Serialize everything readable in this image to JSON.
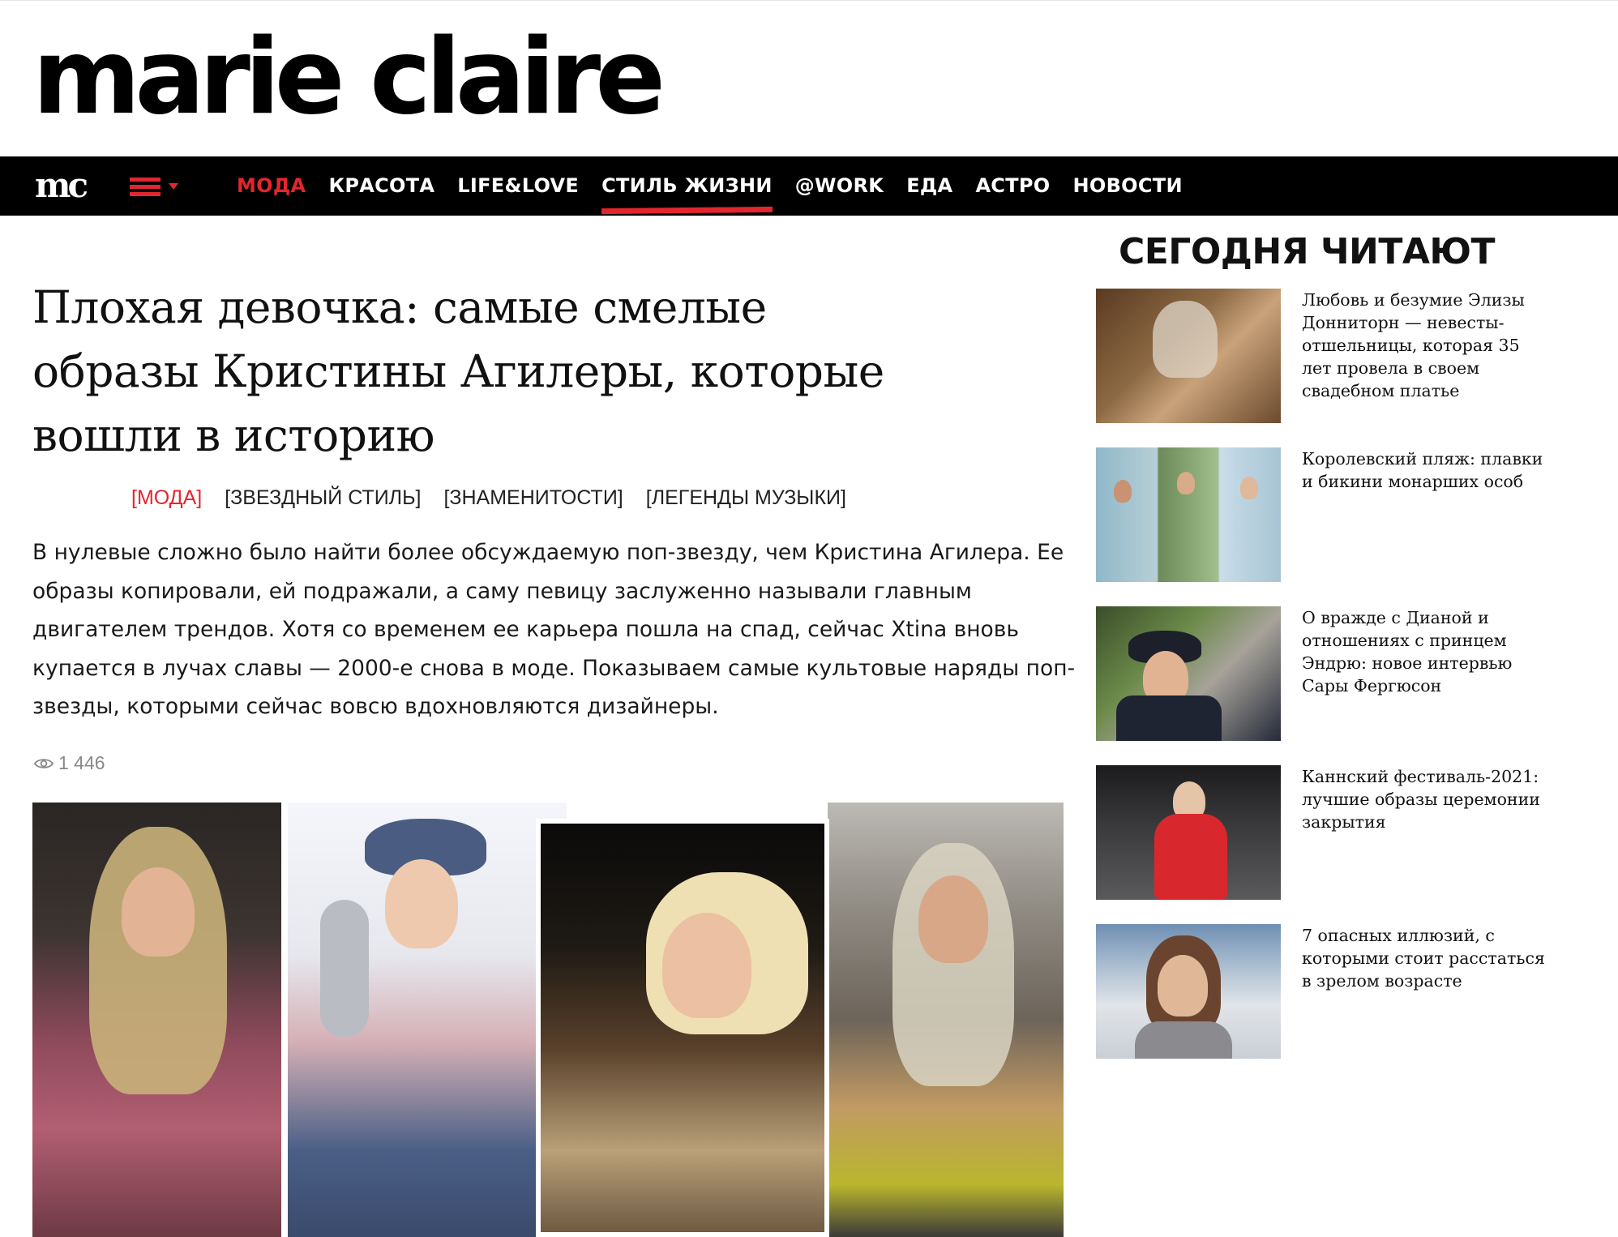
{
  "site": {
    "logo": "marie claire",
    "logo_short": "mc"
  },
  "nav": {
    "menu_icon": "hamburger-icon",
    "items": [
      {
        "label": "МОДА",
        "state": "current-section"
      },
      {
        "label": "КРАСОТА"
      },
      {
        "label": "LIFE&LOVE"
      },
      {
        "label": "СТИЛЬ ЖИЗНИ",
        "state": "underlined"
      },
      {
        "label": "@WORK"
      },
      {
        "label": "ЕДА"
      },
      {
        "label": "АСТРО"
      },
      {
        "label": "НОВОСТИ"
      }
    ]
  },
  "article": {
    "title": "Плохая девочка: самые смелые образы Кристины Агилеры, которые вошли в историю",
    "tags": [
      "[МОДА]",
      "[ЗВЕЗДНЫЙ СТИЛЬ]",
      "[ЗНАМЕНИТОСТИ]",
      "[ЛЕГЕНДЫ МУЗЫКИ]"
    ],
    "lead": "В нулевые сложно было найти более обсуждаемую поп-звезду, чем Кристина Агилера. Ее образы копировали, ей подражали, а саму певицу заслуженно называли главным двигателем трендов. Хотя со временем ее карьера пошла на спад, сейчас Xtina вновь купается в лучах славы — 2000-е снова в моде. Показываем самые культовые наряды поп-звезды, которыми сейчас вовсю вдохновляются дизайнеры.",
    "views": "1 446",
    "views_icon": "eye-icon"
  },
  "sidebar": {
    "title": "СЕГОДНЯ ЧИТАЮТ",
    "items": [
      {
        "text": "Любовь и безумие Элизы Донниторн — невесты-отшельницы, которая 35 лет провела в своем свадебном платье"
      },
      {
        "text": "Королевский пляж: плавки и бикини монарших особ"
      },
      {
        "text": "О вражде с Дианой и отношениях с принцем Эндрю: новое интервью Сары Фергюсон"
      },
      {
        "text": "Каннский фестиваль-2021: лучшие образы церемонии закрытия"
      },
      {
        "text": "7 опасных иллюзий, с которыми стоит расстаться в зрелом возрасте"
      }
    ]
  },
  "colors": {
    "accent": "#e3262e",
    "nav_bg": "#000000",
    "text": "#111111",
    "muted": "#888888"
  }
}
